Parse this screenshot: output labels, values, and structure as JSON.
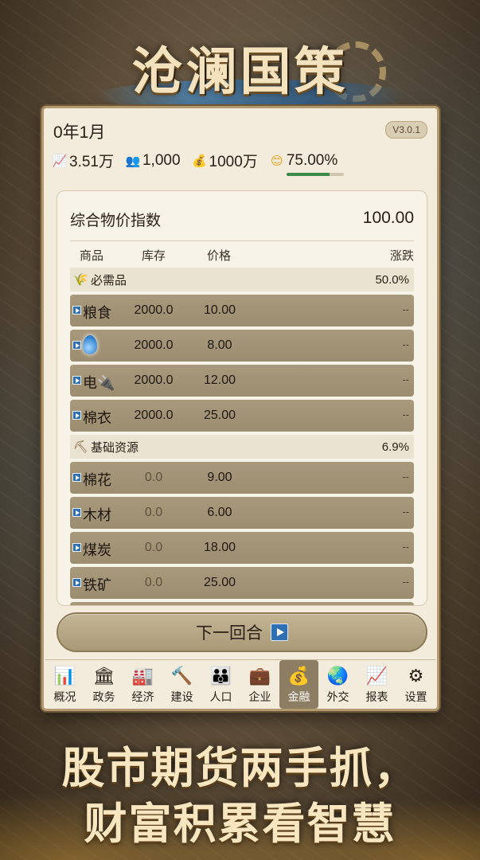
{
  "logo_title": "沧澜国策",
  "header": {
    "date": "0年1月",
    "version": "V3.0.1",
    "stats": {
      "gdp": "3.51万",
      "population": "1,000",
      "treasury": "1000万",
      "happiness": "75.00%",
      "happiness_fraction": 0.75
    }
  },
  "market": {
    "cpi_label": "综合物价指数",
    "cpi_value": "100.00",
    "columns": [
      "商品",
      "库存",
      "价格",
      "涨跌"
    ],
    "categories": [
      {
        "name": "必需品",
        "icon": "wheat-icon",
        "percent": "50.0%",
        "items": [
          {
            "name": "粮食",
            "stock": "2000.0",
            "price": "10.00",
            "change": "--"
          },
          {
            "name": "",
            "icon": "water-drop-icon",
            "stock": "2000.0",
            "price": "8.00",
            "change": "--"
          },
          {
            "name": "电",
            "icon": "plug-icon",
            "stock": "2000.0",
            "price": "12.00",
            "change": "--"
          },
          {
            "name": "棉衣",
            "stock": "2000.0",
            "price": "25.00",
            "change": "--"
          }
        ]
      },
      {
        "name": "基础资源",
        "icon": "pickaxe-icon",
        "percent": "6.9%",
        "items": [
          {
            "name": "棉花",
            "stock": "0.0",
            "price": "9.00",
            "change": "--"
          },
          {
            "name": "木材",
            "stock": "0.0",
            "price": "6.00",
            "change": "--"
          },
          {
            "name": "煤炭",
            "stock": "0.0",
            "price": "18.00",
            "change": "--"
          },
          {
            "name": "铁矿",
            "stock": "0.0",
            "price": "25.00",
            "change": "--"
          }
        ]
      }
    ]
  },
  "next_turn_label": "下一回合",
  "nav": [
    {
      "label": "概况",
      "icon": "bar-chart-icon"
    },
    {
      "label": "政务",
      "icon": "government-building-icon"
    },
    {
      "label": "经济",
      "icon": "factory-icon"
    },
    {
      "label": "建设",
      "icon": "hammer-icon"
    },
    {
      "label": "人口",
      "icon": "people-icon"
    },
    {
      "label": "企业",
      "icon": "briefcase-icon"
    },
    {
      "label": "金融",
      "icon": "money-bag-icon",
      "active": true
    },
    {
      "label": "外交",
      "icon": "globe-icon"
    },
    {
      "label": "报表",
      "icon": "line-chart-icon"
    },
    {
      "label": "设置",
      "icon": "gear-icon"
    }
  ],
  "slogan": {
    "line1": "股市期货两手抓，",
    "line2": "财富积累看智慧"
  }
}
